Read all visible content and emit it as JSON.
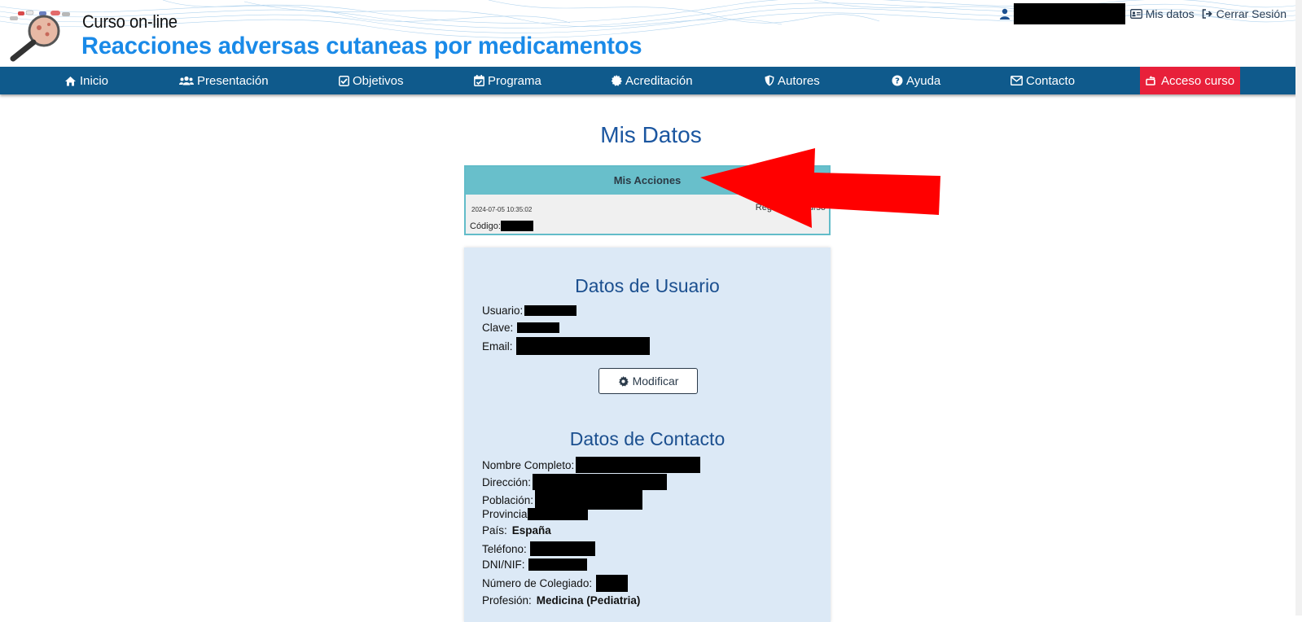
{
  "header": {
    "site_subtitle": "Curso on-line",
    "site_title": "Reacciones adversas cutaneas por medicamentos",
    "links": {
      "mis_datos": "Mis datos",
      "cerrar_sesion": "Cerrar Sesión"
    }
  },
  "nav": {
    "items": [
      {
        "label": "Inicio",
        "icon": "home-icon"
      },
      {
        "label": "Presentación",
        "icon": "users-icon"
      },
      {
        "label": "Objetivos",
        "icon": "check-square-icon"
      },
      {
        "label": "Programa",
        "icon": "calendar-check-icon"
      },
      {
        "label": "Acreditación",
        "icon": "certificate-icon"
      },
      {
        "label": "Autores",
        "icon": "shield-icon"
      },
      {
        "label": "Ayuda",
        "icon": "question-circle-icon"
      },
      {
        "label": "Contacto",
        "icon": "envelope-icon"
      },
      {
        "label": "Acceso curso",
        "icon": "hand-pointer-icon"
      }
    ],
    "accent_color": "#e8203a",
    "bar_color": "#0f5a8c"
  },
  "main": {
    "title": "Mis Datos",
    "acciones": {
      "header": "Mis Acciones",
      "date": "2024-07-05 10:35:02",
      "code_label": "Código:",
      "action": "Registro en curso"
    },
    "usuario": {
      "heading": "Datos de Usuario",
      "usuario_label": "Usuario:",
      "clave_label": "Clave:",
      "email_label": "Email:",
      "modify_button": "Modificar"
    },
    "contacto": {
      "heading": "Datos de Contacto",
      "nombre_label": "Nombre Completo:",
      "direccion_label": "Dirección:",
      "poblacion_label": "Población:",
      "provincia_label": "Provincia",
      "pais_label": "País:",
      "pais_value": "España",
      "telefono_label": "Teléfono:",
      "dni_label": "DNI/NIF:",
      "colegiado_label": "Número de Colegiado:",
      "profesion_label": "Profesión:",
      "profesion_value": "Medicina (Pediatria)"
    }
  }
}
